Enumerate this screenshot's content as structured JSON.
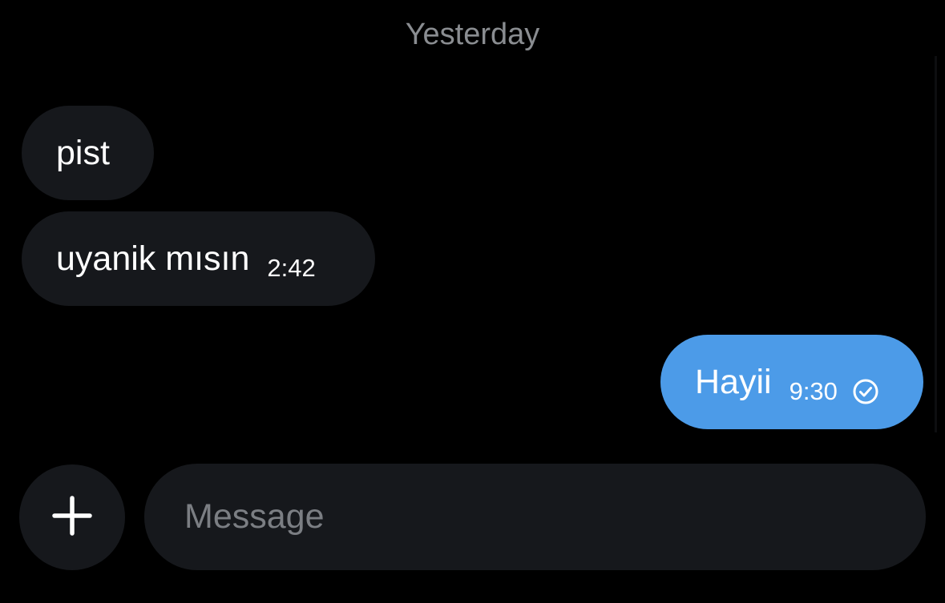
{
  "conversation": {
    "date_separator": "Yesterday",
    "messages": [
      {
        "direction": "incoming",
        "text": "pist",
        "time": ""
      },
      {
        "direction": "incoming",
        "text": "uyanik mısın",
        "time": "2:42"
      },
      {
        "direction": "outgoing",
        "text": "Hayii",
        "time": "9:30",
        "status_icon": "check-circle-icon"
      }
    ]
  },
  "composer": {
    "add_icon": "plus-icon",
    "message_placeholder": "Message",
    "message_value": ""
  },
  "colors": {
    "background": "#000000",
    "incoming_bubble": "#16181c",
    "outgoing_bubble": "#4c9be8",
    "muted_text": "#8a8d91"
  }
}
